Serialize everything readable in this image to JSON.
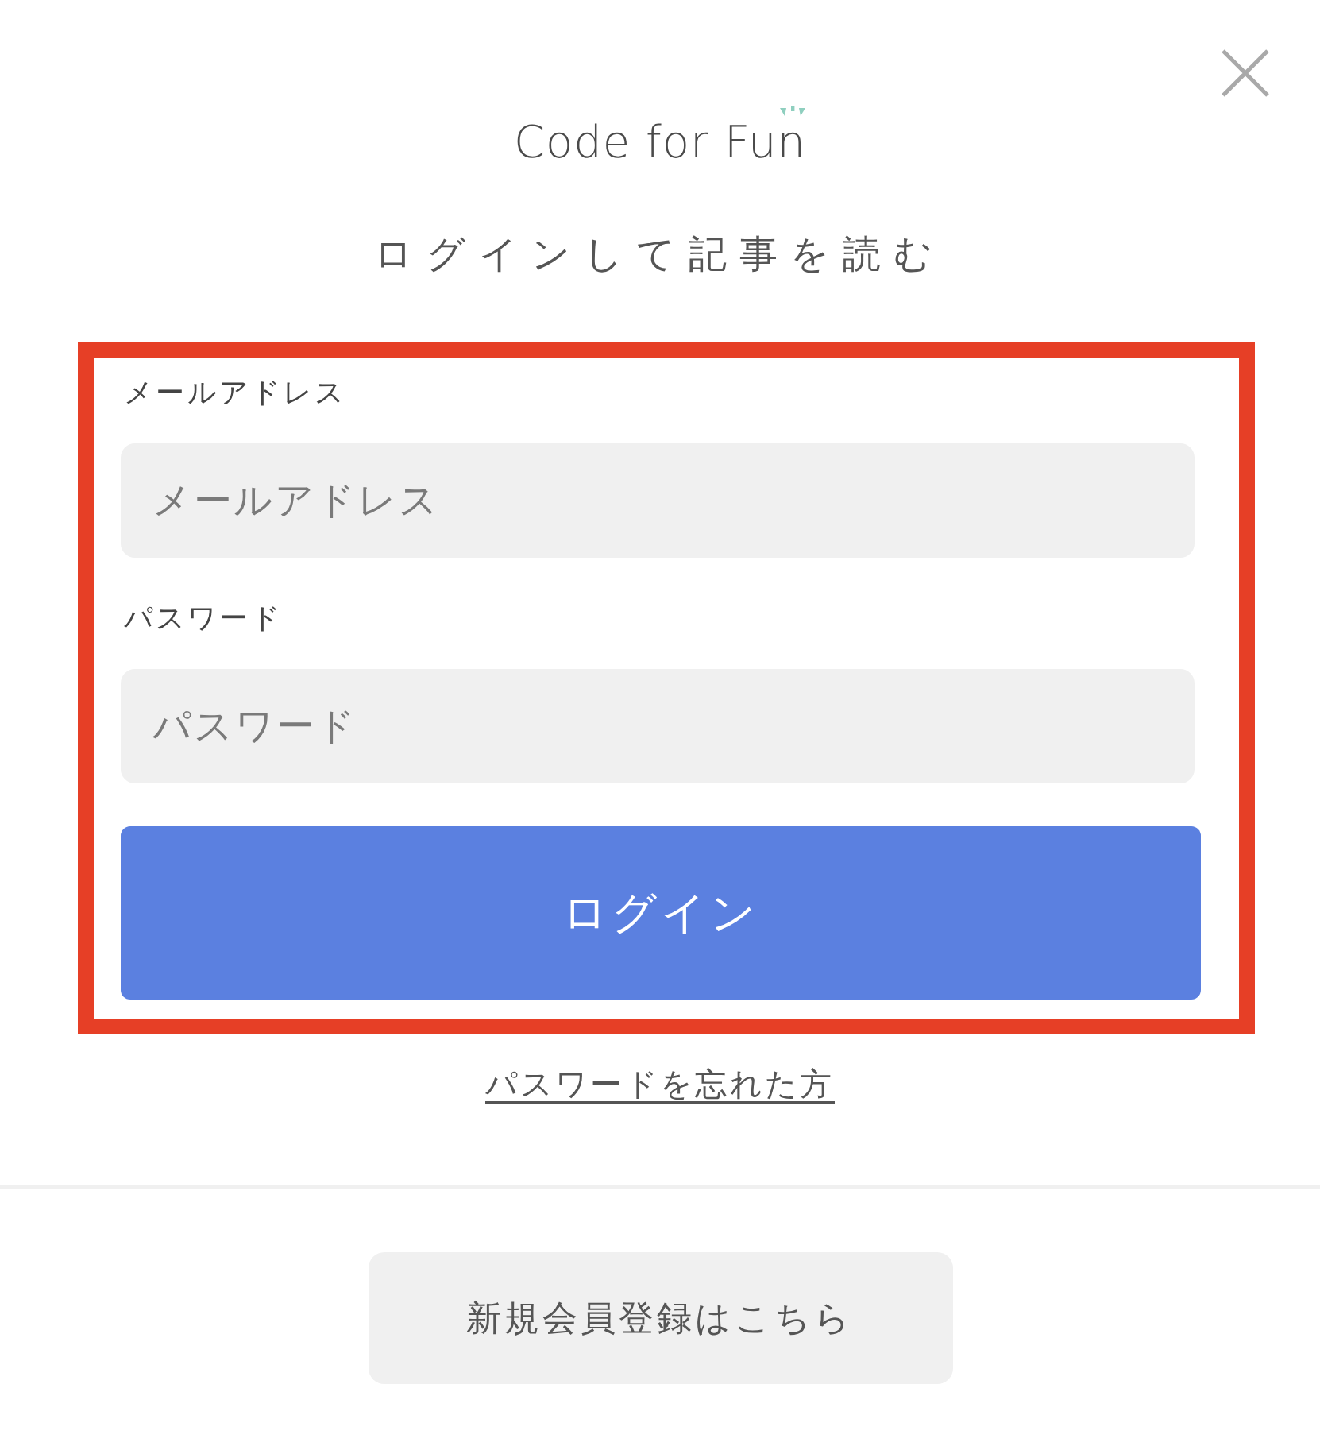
{
  "logo": {
    "text": "Code for Fun"
  },
  "heading": "ログインして記事を読む",
  "form": {
    "highlighted": true,
    "fields": [
      {
        "label": "メールアドレス",
        "placeholder": "メールアドレス"
      },
      {
        "label": "パスワード",
        "placeholder": "パスワード"
      }
    ],
    "submit": "ログイン"
  },
  "forgot_link": "パスワードを忘れた方",
  "signup_button": "新規会員登録はこちら"
}
